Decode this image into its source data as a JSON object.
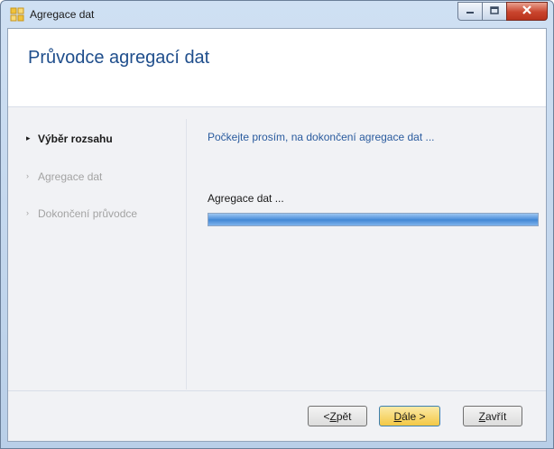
{
  "window": {
    "title": "Agregace dat",
    "app_icon": "grid-app-icon"
  },
  "header": {
    "title": "Průvodce agregací dat"
  },
  "steps": [
    {
      "label": "Výběr rozsahu",
      "state": "active"
    },
    {
      "label": "Agregace dat",
      "state": "inactive"
    },
    {
      "label": "Dokončení průvodce",
      "state": "inactive"
    }
  ],
  "content": {
    "info": "Počkejte prosím, na dokončení agregace dat ...",
    "progress_label": "Agregace dat ...",
    "progress_fraction": 1.0
  },
  "footer": {
    "back": {
      "mnemonic": "Z",
      "rest": "pět",
      "prefix": "< "
    },
    "next": {
      "mnemonic": "D",
      "rest": "ále >"
    },
    "close": {
      "mnemonic": "Z",
      "rest": "avřít"
    }
  },
  "colors": {
    "header_title": "#1f4e8c",
    "info_text": "#2a5b9e",
    "progress_fill": "#4b8fda",
    "next_button": "#f3c845"
  }
}
